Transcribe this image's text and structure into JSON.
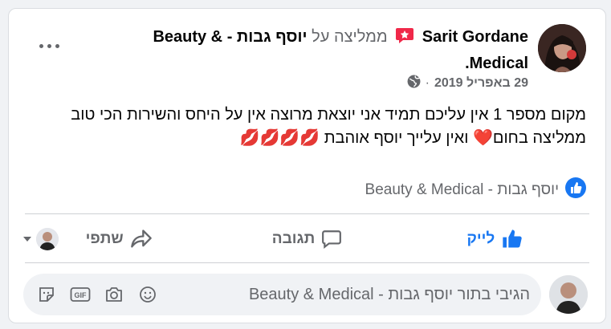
{
  "post": {
    "author": "Sarit Gordane",
    "recommends": "ממליצה על",
    "page_name": "יוסף גבות - Beauty & Medical",
    "period": ".",
    "date": "29 באפריל 2019",
    "separator": "·",
    "text": "מקום מספר 1 אין עליכם תמיד אני יוצאת מרוצה אין על היחס והשירות הכי טוב ממליצה בחום❤️ ואין עלייך יוסף אוהבת 💋💋💋💋"
  },
  "reactions": {
    "liker": "יוסף גבות - Beauty & Medical"
  },
  "actions": {
    "like": "לייק",
    "comment": "תגובה",
    "share": "שתפי"
  },
  "comment": {
    "placeholder": "הגיבי בתור יוסף גבות - Beauty & Medical",
    "icons": [
      "emoji-icon",
      "camera-icon",
      "gif-icon",
      "sticker-icon"
    ]
  },
  "colors": {
    "accent": "#1877f2",
    "muted": "#65676b",
    "badge": "#f02849"
  }
}
